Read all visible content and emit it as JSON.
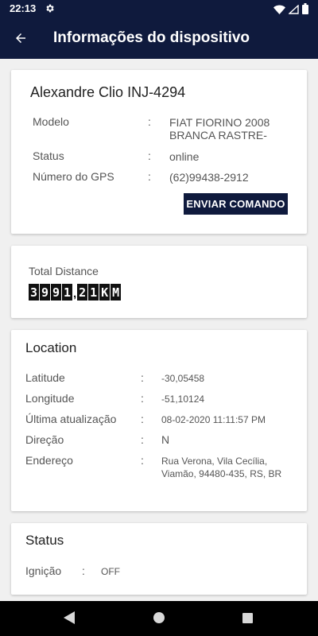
{
  "status_bar": {
    "time": "22:13"
  },
  "app_bar": {
    "title": "Informações do dispositivo"
  },
  "device": {
    "name": "Alexandre Clio INJ-4294",
    "fields": [
      {
        "label": "Modelo",
        "value": "FIAT FIORINO 2008",
        "value2": "BRANCA RASTRE-"
      },
      {
        "label": "Status",
        "value": "online"
      },
      {
        "label": "Número do GPS",
        "value": "(62)99438-2912"
      }
    ],
    "send_command_label": "ENVIAR COMANDO"
  },
  "distance": {
    "title": "Total Distance",
    "digits": [
      "3",
      "9",
      "9",
      "1",
      ",",
      "2",
      "1",
      "K",
      "M"
    ]
  },
  "location": {
    "title": "Location",
    "fields": [
      {
        "label": "Latitude",
        "value": "-30,05458"
      },
      {
        "label": "Longitude",
        "value": "-51,10124"
      },
      {
        "label": "Última atualização",
        "value": "08-02-2020 11:11:57 PM"
      },
      {
        "label": "Direção",
        "value": "N"
      },
      {
        "label": "Endereço",
        "value": "Rua Verona, Vila Cecília,",
        "value2": "Viamão, 94480-435, RS, BR"
      }
    ]
  },
  "status_section": {
    "title": "Status",
    "fields": [
      {
        "label": "Ignição",
        "value": "OFF"
      }
    ]
  },
  "colors": {
    "primary": "#0f1a3d",
    "background": "#f0f0f0"
  }
}
